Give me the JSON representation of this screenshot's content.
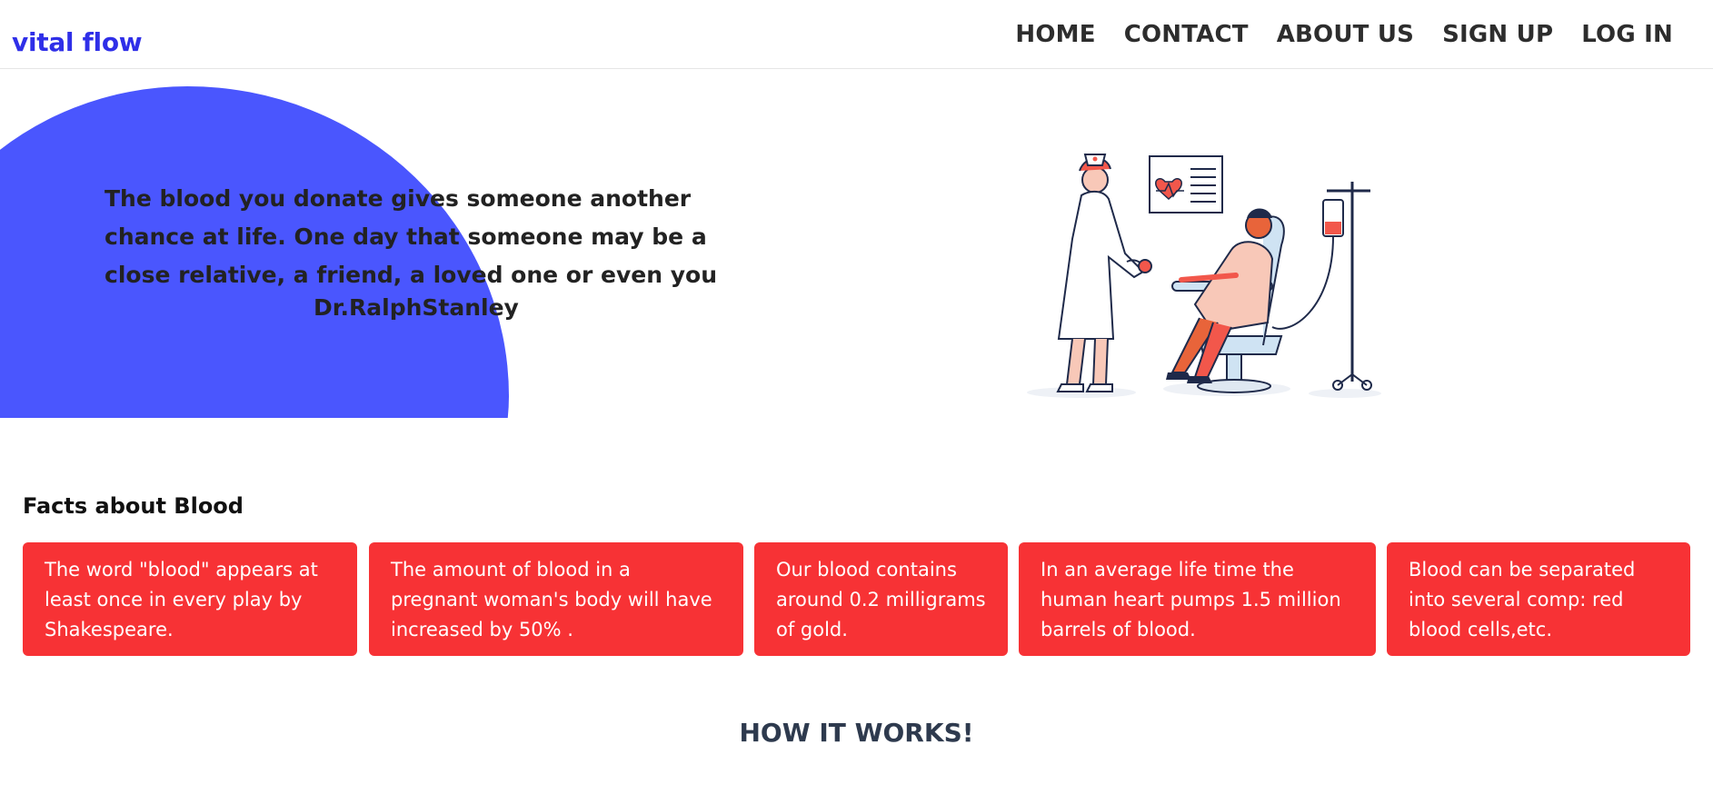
{
  "brand": "vital flow",
  "nav": [
    "HOME",
    "CONTACT",
    "ABOUT US",
    "SIGN UP",
    "LOG IN"
  ],
  "hero": {
    "quote": "The blood you donate gives someone another chance at life. One day that someone may be a close relative, a friend, a loved one or even you",
    "author": "Dr.RalphStanley",
    "illustration": "nurse-and-blood-donor-illustration"
  },
  "facts": {
    "title": "Facts about Blood",
    "items": [
      "The word \"blood\" appears at least once in every play by Shakespeare.",
      "The amount of blood in a pregnant woman's body will have increased by 50% .",
      "Our blood contains around 0.2 milligrams of gold.",
      "In an average life time the human heart pumps 1.5 million barrels of blood.",
      "Blood can be separated into several comp: red blood cells,etc."
    ]
  },
  "how_it_works": "HOW IT WORKS!",
  "colors": {
    "brand": "#2f2fe8",
    "blob": "#4a56fe",
    "card": "#f73235"
  }
}
